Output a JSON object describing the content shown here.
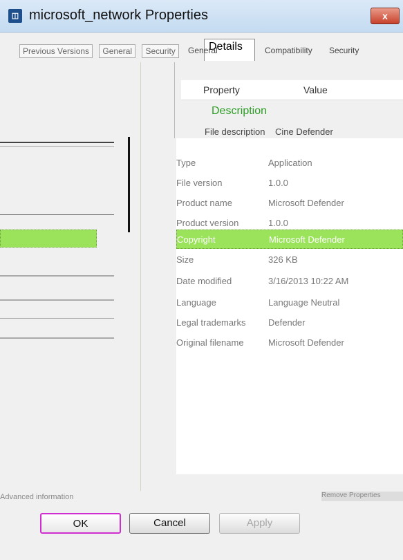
{
  "window": {
    "title": "microsoft_network Properties",
    "icon": "properties-icon",
    "close_label": "x"
  },
  "background_window": {
    "tabs": [
      "Previous Versions",
      "General",
      "Security"
    ],
    "bottom_link": "Advanced information",
    "bottom_right": "Remove Properties"
  },
  "tabs": {
    "active": "Details",
    "visible": [
      "General",
      "Compatibility",
      "Security"
    ]
  },
  "table": {
    "header_property": "Property",
    "header_value": "Value",
    "section": "Description",
    "file_description_label": "File description",
    "file_description_value": "Cine Defender",
    "rows": [
      {
        "property": "Type",
        "value": "Application"
      },
      {
        "property": "File version",
        "value": "1.0.0"
      },
      {
        "property": "Product name",
        "value": "Microsoft Defender"
      },
      {
        "property": "Product version",
        "value": "1.0.0"
      },
      {
        "property": "Copyright",
        "value": "Microsoft Defender",
        "selected": true
      },
      {
        "property": "Size",
        "value": "326 KB"
      },
      {
        "property": "Date modified",
        "value": "3/16/2013 10:22 AM"
      },
      {
        "property": "Language",
        "value": "Language Neutral"
      },
      {
        "property": "Legal trademarks",
        "value": "Defender"
      },
      {
        "property": "Original filename",
        "value": "Microsoft Defender"
      }
    ]
  },
  "buttons": {
    "ok": "OK",
    "cancel": "Cancel",
    "apply": "Apply"
  },
  "colors": {
    "selection": "#9ae35b",
    "section_text": "#2b9d22",
    "ok_focus": "#d12ed1"
  }
}
